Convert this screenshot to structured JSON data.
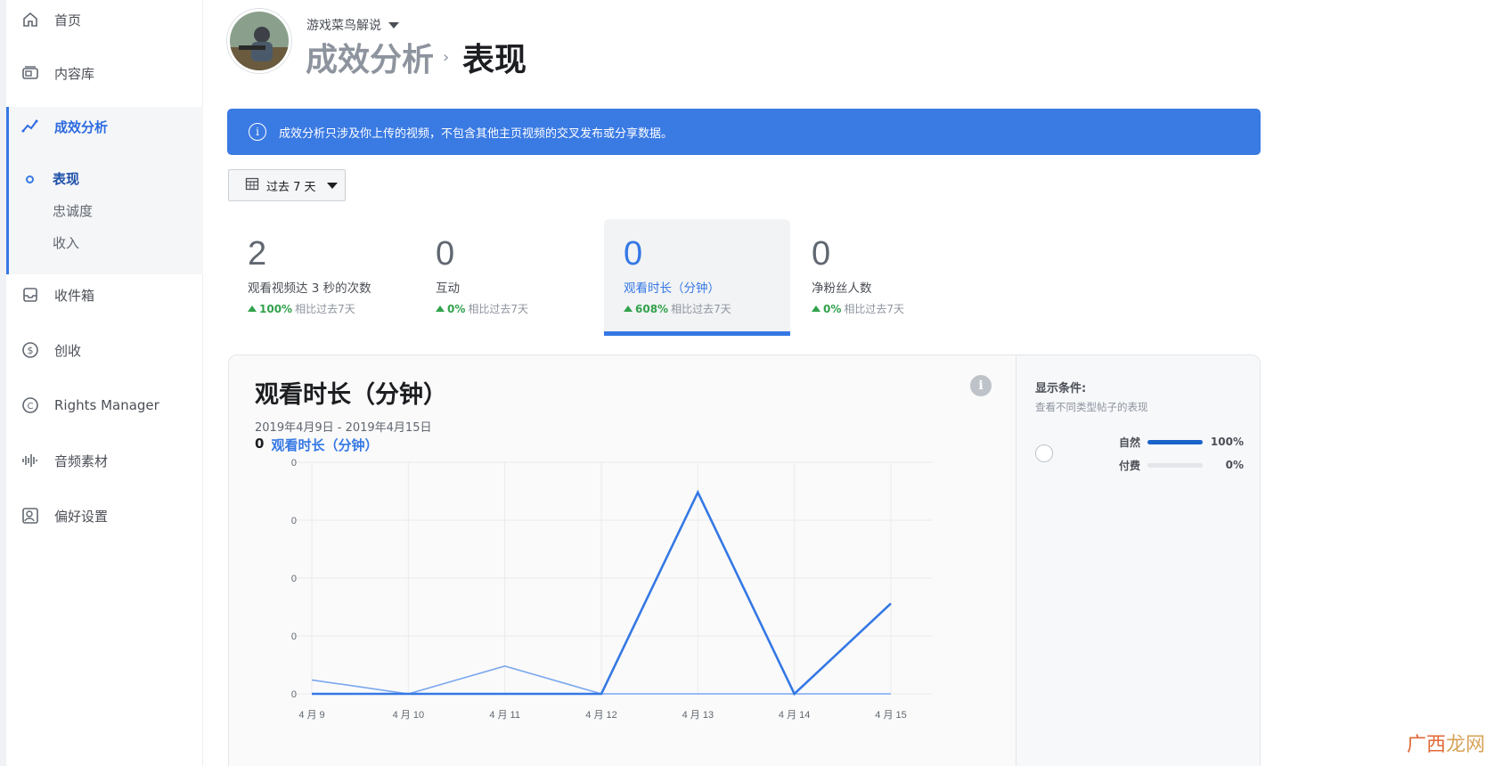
{
  "sidebar": {
    "items": [
      {
        "label": "首页",
        "icon": "home-icon"
      },
      {
        "label": "内容库",
        "icon": "library-icon"
      },
      {
        "label": "成效分析",
        "icon": "analytics-icon"
      },
      {
        "label": "收件箱",
        "icon": "inbox-icon"
      },
      {
        "label": "创收",
        "icon": "dollar-icon"
      },
      {
        "label": "Rights Manager",
        "icon": "copyright-icon"
      },
      {
        "label": "音频素材",
        "icon": "audio-icon"
      },
      {
        "label": "偏好设置",
        "icon": "settings-icon"
      }
    ],
    "subitems": [
      {
        "label": "表现",
        "active": true
      },
      {
        "label": "忠诚度",
        "active": false
      },
      {
        "label": "收入",
        "active": false
      }
    ]
  },
  "header": {
    "page_name": "游戏菜鸟解说",
    "breadcrumb_parent": "成效分析",
    "breadcrumb_sep": "›",
    "breadcrumb_current": "表现"
  },
  "banner": {
    "text": "成效分析只涉及你上传的视频，不包含其他主页视频的交叉发布或分享数据。"
  },
  "date_filter": {
    "label": "过去 7 天"
  },
  "metrics": [
    {
      "value": "2",
      "label": "观看视频达 3 秒的次数",
      "change": "100%",
      "compare": "相比过去7天",
      "active": false
    },
    {
      "value": "0",
      "label": "互动",
      "change": "0%",
      "compare": "相比过去7天",
      "active": false
    },
    {
      "value": "0",
      "label": "观看时长（分钟）",
      "change": "608%",
      "compare": "相比过去7天",
      "active": true
    },
    {
      "value": "0",
      "label": "净粉丝人数",
      "change": "0%",
      "compare": "相比过去7天",
      "active": false
    }
  ],
  "chart_card": {
    "title": "观看时长（分钟）",
    "date_range": "2019年4月9日 - 2019年4月15日",
    "summary_value": "0",
    "summary_metric": "观看时长（分钟）",
    "filter_title": "显示条件:",
    "filter_sub": "查看不同类型帖子的表现",
    "breakdown": [
      {
        "label": "自然",
        "value": "100%",
        "fraction": 1.0
      },
      {
        "label": "付费",
        "value": "0%",
        "fraction": 0.0
      }
    ]
  },
  "chart_data": {
    "type": "line",
    "categories": [
      "4 月 9",
      "4 月 10",
      "4 月 11",
      "4 月 12",
      "4 月 13",
      "4 月 14",
      "4 月 15"
    ],
    "y_tick_labels": [
      "0",
      "0",
      "0",
      "0",
      "0"
    ],
    "ylim": [
      0,
      1
    ],
    "series": [
      {
        "values": [
          0,
          0,
          0,
          0,
          0.87,
          0,
          0.39
        ],
        "color": "#3578e5",
        "emphasis": "primary"
      },
      {
        "values": [
          0.06,
          0,
          0.12,
          0,
          0,
          0,
          0
        ],
        "color": "#7aa7ef",
        "emphasis": "secondary"
      }
    ],
    "grid": true
  },
  "watermark": {
    "part1": "广西",
    "part2": "龙网"
  },
  "colors": {
    "accent": "#3578e5",
    "banner": "#3a7ae3",
    "positive": "#31a24c"
  }
}
